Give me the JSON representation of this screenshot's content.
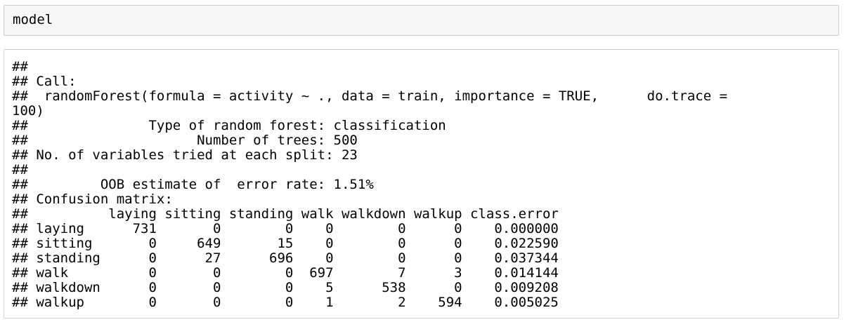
{
  "input_cell": {
    "code": "model"
  },
  "output_cell": {
    "lines": [
      "##",
      "## Call:",
      "##  randomForest(formula = activity ~ ., data = train, importance = TRUE,      do.trace =",
      "100)",
      "##               Type of random forest: classification",
      "##                     Number of trees: 500",
      "## No. of variables tried at each split: 23",
      "##",
      "##         OOB estimate of  error rate: 1.51%",
      "## Confusion matrix:",
      "##          laying sitting standing walk walkdown walkup class.error",
      "## laying      731       0        0    0        0      0    0.000000",
      "## sitting       0     649       15    0        0      0    0.022590",
      "## standing      0      27      696    0        0      0    0.037344",
      "## walk          0       0        0  697        7      3    0.014144",
      "## walkdown      0       0        0    5      538      0    0.009208",
      "## walkup        0       0        0    1        2    594    0.005025"
    ]
  }
}
